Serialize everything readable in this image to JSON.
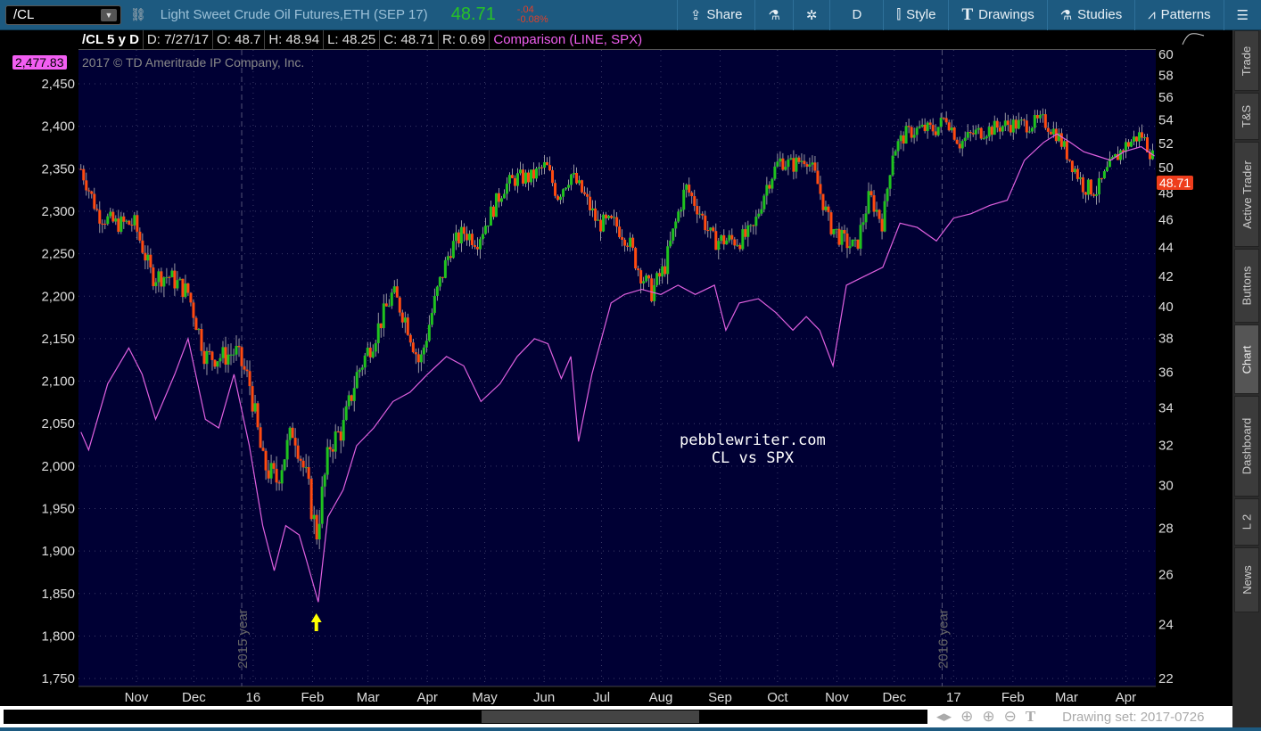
{
  "toolbar": {
    "symbol": "/CL",
    "description": "Light Sweet Crude Oil Futures,ETH (SEP 17)",
    "last": "48.71",
    "change": "-.04",
    "change_pct": "-0.08%",
    "share": "Share",
    "period": "D",
    "style": "Style",
    "drawings": "Drawings",
    "studies": "Studies",
    "patterns": "Patterns"
  },
  "header": {
    "title": "/CL 5 y D",
    "date": "D: 7/27/17",
    "open": "O: 48.7",
    "high": "H: 48.94",
    "low": "L: 48.25",
    "close": "C: 48.71",
    "range": "R: 0.69",
    "comparison": "Comparison (LINE, SPX)"
  },
  "overlay": {
    "spx_tag": "2,477.83",
    "copyright": "2017 © TD Ameritrade IP Company, Inc.",
    "price_tag": "48.71",
    "watermark_line1": "pebblewriter.com",
    "watermark_line2": "CL vs SPX"
  },
  "sidebar": [
    "Trade",
    "T&S",
    "Active Trader",
    "Buttons",
    "Chart",
    "Dashboard",
    "L 2",
    "News"
  ],
  "bottom": {
    "drawing_set": "Drawing set: 2017-0726"
  },
  "colors": {
    "up": "#1fc21f",
    "down": "#ff4a10",
    "spx": "#e060e0",
    "bg": "#000034"
  },
  "chart_data": {
    "type": "line",
    "x_unit": "days since 2015-11-01",
    "xlim": [
      -30,
      535
    ],
    "left_axis": {
      "label": "SPX",
      "ticks": [
        2450,
        2400,
        2350,
        2300,
        2250,
        2200,
        2150,
        2100,
        2050,
        2000,
        1950,
        1900,
        1850,
        1800,
        1750
      ],
      "ylim": [
        1750,
        2450
      ]
    },
    "right_axis": {
      "label": "CL",
      "scale": "log",
      "ticks": [
        60,
        58,
        56,
        54,
        52,
        50,
        48,
        46,
        44,
        42,
        40,
        38,
        36,
        34,
        32,
        30,
        28,
        26,
        24,
        22
      ],
      "ylim": [
        22,
        60
      ]
    },
    "x_ticks": [
      {
        "label": "Nov",
        "day": 0
      },
      {
        "label": "Dec",
        "day": 30
      },
      {
        "label": "16",
        "day": 61
      },
      {
        "label": "Feb",
        "day": 92
      },
      {
        "label": "Mar",
        "day": 121
      },
      {
        "label": "Apr",
        "day": 152
      },
      {
        "label": "May",
        "day": 182
      },
      {
        "label": "Jun",
        "day": 213
      },
      {
        "label": "Jul",
        "day": 243
      },
      {
        "label": "Aug",
        "day": 274
      },
      {
        "label": "Sep",
        "day": 305
      },
      {
        "label": "Oct",
        "day": 335
      },
      {
        "label": "Nov",
        "day": 366
      },
      {
        "label": "Dec",
        "day": 396
      },
      {
        "label": "17",
        "day": 427
      },
      {
        "label": "Feb",
        "day": 458
      },
      {
        "label": "Mar",
        "day": 486
      },
      {
        "label": "Apr",
        "day": 517
      }
    ],
    "year_markers": [
      {
        "label": "2015 year",
        "day": 55
      },
      {
        "label": "2016 year",
        "day": 421
      }
    ],
    "annotation": {
      "type": "arrow",
      "day": 94,
      "color": "#ffff00"
    },
    "series": [
      {
        "name": "CL (candles, close)",
        "axis": "right",
        "points": [
          [
            -29,
            49.9
          ],
          [
            -20,
            46.4
          ],
          [
            -11,
            45.7
          ],
          [
            -1,
            45.7
          ],
          [
            8,
            42.0
          ],
          [
            17,
            42.0
          ],
          [
            27,
            40.9
          ],
          [
            36,
            36.9
          ],
          [
            45,
            36.9
          ],
          [
            52,
            37.2
          ],
          [
            59,
            35.4
          ],
          [
            66,
            31.1
          ],
          [
            73,
            30.2
          ],
          [
            82,
            32.9
          ],
          [
            89,
            30.2
          ],
          [
            94,
            27.7
          ],
          [
            101,
            32.0
          ],
          [
            108,
            32.9
          ],
          [
            115,
            35.8
          ],
          [
            124,
            38.0
          ],
          [
            134,
            40.9
          ],
          [
            141,
            39.1
          ],
          [
            148,
            36.4
          ],
          [
            157,
            40.9
          ],
          [
            164,
            43.9
          ],
          [
            171,
            45.1
          ],
          [
            178,
            44.5
          ],
          [
            185,
            46.4
          ],
          [
            192,
            48.5
          ],
          [
            199,
            49.2
          ],
          [
            206,
            49.2
          ],
          [
            214,
            50.2
          ],
          [
            220,
            47.8
          ],
          [
            227,
            49.5
          ],
          [
            234,
            47.8
          ],
          [
            241,
            45.7
          ],
          [
            250,
            45.7
          ],
          [
            257,
            44.5
          ],
          [
            262,
            42.6
          ],
          [
            269,
            40.9
          ],
          [
            276,
            42.6
          ],
          [
            283,
            46.4
          ],
          [
            287,
            48.5
          ],
          [
            294,
            46.7
          ],
          [
            301,
            44.5
          ],
          [
            308,
            44.5
          ],
          [
            315,
            44.5
          ],
          [
            322,
            45.1
          ],
          [
            329,
            48.5
          ],
          [
            336,
            50.6
          ],
          [
            343,
            50.2
          ],
          [
            350,
            50.9
          ],
          [
            355,
            49.2
          ],
          [
            362,
            45.7
          ],
          [
            369,
            44.5
          ],
          [
            376,
            43.9
          ],
          [
            383,
            47.8
          ],
          [
            390,
            45.7
          ],
          [
            395,
            51.3
          ],
          [
            402,
            52.8
          ],
          [
            409,
            53.2
          ],
          [
            418,
            53.2
          ],
          [
            423,
            54.3
          ],
          [
            430,
            52.0
          ],
          [
            437,
            52.8
          ],
          [
            446,
            53.2
          ],
          [
            455,
            53.6
          ],
          [
            465,
            53.6
          ],
          [
            474,
            53.9
          ],
          [
            481,
            52.8
          ],
          [
            488,
            50.6
          ],
          [
            495,
            48.5
          ],
          [
            502,
            48.2
          ],
          [
            509,
            50.2
          ],
          [
            516,
            51.7
          ],
          [
            525,
            52.8
          ],
          [
            532,
            50.6
          ]
        ]
      },
      {
        "name": "SPX",
        "axis": "left",
        "points": [
          [
            -29,
            2040
          ],
          [
            -25,
            2019
          ],
          [
            -15,
            2097
          ],
          [
            -4,
            2139
          ],
          [
            3,
            2108
          ],
          [
            10,
            2055
          ],
          [
            20,
            2108
          ],
          [
            27,
            2150
          ],
          [
            36,
            2055
          ],
          [
            43,
            2045
          ],
          [
            51,
            2108
          ],
          [
            59,
            2024
          ],
          [
            66,
            1930
          ],
          [
            72,
            1877
          ],
          [
            78,
            1930
          ],
          [
            85,
            1919
          ],
          [
            89,
            1888
          ],
          [
            95,
            1840
          ],
          [
            100,
            1940
          ],
          [
            108,
            1972
          ],
          [
            115,
            2024
          ],
          [
            124,
            2045
          ],
          [
            134,
            2076
          ],
          [
            143,
            2087
          ],
          [
            152,
            2108
          ],
          [
            162,
            2129
          ],
          [
            171,
            2118
          ],
          [
            180,
            2076
          ],
          [
            190,
            2097
          ],
          [
            199,
            2129
          ],
          [
            208,
            2150
          ],
          [
            215,
            2144
          ],
          [
            222,
            2103
          ],
          [
            227,
            2129
          ],
          [
            231,
            2029
          ],
          [
            238,
            2108
          ],
          [
            248,
            2192
          ],
          [
            255,
            2202
          ],
          [
            264,
            2208
          ],
          [
            274,
            2202
          ],
          [
            283,
            2213
          ],
          [
            292,
            2202
          ],
          [
            302,
            2213
          ],
          [
            308,
            2160
          ],
          [
            315,
            2192
          ],
          [
            325,
            2197
          ],
          [
            334,
            2181
          ],
          [
            343,
            2160
          ],
          [
            350,
            2176
          ],
          [
            357,
            2160
          ],
          [
            364,
            2118
          ],
          [
            371,
            2213
          ],
          [
            380,
            2223
          ],
          [
            390,
            2234
          ],
          [
            399,
            2286
          ],
          [
            408,
            2281
          ],
          [
            418,
            2265
          ],
          [
            427,
            2292
          ],
          [
            436,
            2297
          ],
          [
            446,
            2307
          ],
          [
            455,
            2313
          ],
          [
            464,
            2360
          ],
          [
            474,
            2381
          ],
          [
            481,
            2391
          ],
          [
            488,
            2381
          ],
          [
            495,
            2370
          ],
          [
            502,
            2365
          ],
          [
            509,
            2360
          ],
          [
            516,
            2370
          ],
          [
            525,
            2376
          ],
          [
            532,
            2365
          ]
        ]
      }
    ]
  }
}
